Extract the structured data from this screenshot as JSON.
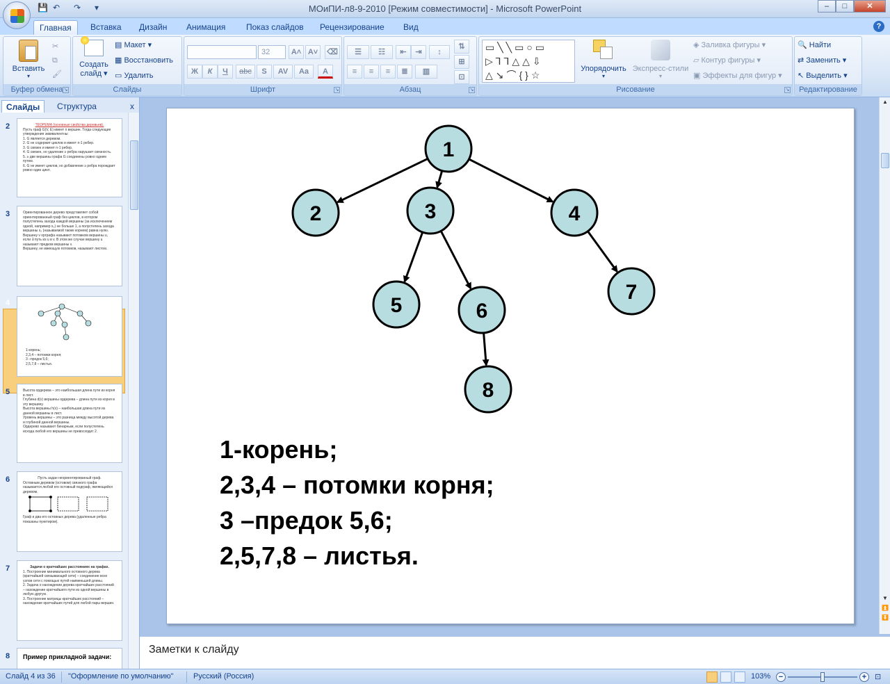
{
  "window": {
    "title": "МОиПИ-л8-9-2010 [Режим совместимости] - Microsoft PowerPoint",
    "minimize": "–",
    "maximize": "□",
    "close": "✕"
  },
  "tabs": [
    {
      "label": "Главная"
    },
    {
      "label": "Вставка"
    },
    {
      "label": "Дизайн"
    },
    {
      "label": "Анимация"
    },
    {
      "label": "Показ слайдов"
    },
    {
      "label": "Рецензирование"
    },
    {
      "label": "Вид"
    }
  ],
  "ribbon": {
    "clipboard": {
      "label": "Буфер обмена",
      "paste": "Вставить"
    },
    "slides": {
      "label": "Слайды",
      "create_line1": "Создать",
      "create_line2": "слайд ▾",
      "layout": "Макет ▾",
      "reset": "Восстановить",
      "delete": "Удалить"
    },
    "font": {
      "label": "Шрифт",
      "font_name": "",
      "font_size": "32",
      "bold": "Ж",
      "italic": "К",
      "underline": "Ч",
      "strike": "abc",
      "shadow": "S",
      "spacing": "AV",
      "case": "Aa",
      "color": "A"
    },
    "paragraph": {
      "label": "Абзац"
    },
    "drawing": {
      "label": "Рисование",
      "arrange": "Упорядочить",
      "quick_styles": "Экспресс-стили",
      "fill": "Заливка фигуры ▾",
      "outline": "Контур фигуры ▾",
      "effects": "Эффекты для фигур ▾"
    },
    "editing": {
      "label": "Редактирование",
      "find": "Найти",
      "replace": "Заменить ▾",
      "select": "Выделить ▾"
    }
  },
  "left_panel": {
    "tab_slides": "Слайды",
    "tab_outline": "Структура",
    "close": "x",
    "thumbnails": [
      {
        "number": "2",
        "lines": [
          "ТЕОРЕМА (основные свойства деревьев).",
          "Пусть граф G(V, E) имеет n вершин. Тогда следующие утверждения эквивалентны:",
          "1. G является деревом.",
          "2. G не содержит циклов и имеет n-1 ребер.",
          "3. G связен и имеет n-1 ребер.",
          "4. G связен, но удаление ≥ ребра нарушает связность.",
          "5. ≥ две вершины графа G соединены ровно одним путем.",
          "6. G не имеет циклов, но добавление ≥ ребра порождает ровно один цикл."
        ]
      },
      {
        "number": "3",
        "lines": [
          "Ориентированное дерево представляет собой ориентированный граф без циклов, в котором полустепень захода каждой вершины (за исключением одной, например x₀) не больше 1, а полустепень захода вершины x₀ (называемой также корнем) равна нулю.",
          "Вершину v орграфа называют потомком вершины u, если ∃ путь из u в v. В этом же случае вершину u называют предком вершины v.",
          "Вершину, не имеющую потомков, называют листом."
        ]
      },
      {
        "number": "4",
        "lines": [
          "1-корень;",
          "2,3,4 – потомки корня;",
          "3 –предок 5,6;",
          "2,5,7,8 – листья."
        ]
      },
      {
        "number": "5",
        "lines": [
          "Высота ордерева – это наибольшая длина пути из корня в лист.",
          "Глубина d(v) вершины ордерева – длина пути из корня в эту вершину.",
          "Высота вершины h(v) – наибольшая длина пути из данной вершины в лист.",
          "Уровень вершины – это разница между высотой дерева и глубиной данной вершины.",
          "Ордерево называют бинарным, если полустепень исхода любой его вершины не превосходит 2."
        ]
      },
      {
        "number": "6",
        "lines": [
          "Пусть задан неориентированный граф.",
          "Остовным деревом (остовом) связного графа называется любой его остовный подграф, являющийся деревом.",
          "Граф и два его остовных дерева (удаленные ребра показаны пунктиром)."
        ]
      },
      {
        "number": "7",
        "lines": [
          "Задачи о кратчайших расстояниях на графах.",
          "1. Построение минимального остовного дерева (кратчайшей связывающей сети) – соединение всех узлов сети с помощью путей наименьшей длины.",
          "2. Задача о нахождении дерева кратчайших расстояний – нахождение кратчайшего пути из одной вершины в любую другую.",
          "3. Построение матрицы кратчайших расстояний – нахождение кратчайших путей для любой пары вершин."
        ]
      },
      {
        "number": "8",
        "lines": [
          "Пример прикладной задачи:"
        ]
      }
    ]
  },
  "slide": {
    "nodes": [
      {
        "label": "1"
      },
      {
        "label": "2"
      },
      {
        "label": "3"
      },
      {
        "label": "4"
      },
      {
        "label": "5"
      },
      {
        "label": "6"
      },
      {
        "label": "7"
      },
      {
        "label": "8"
      }
    ],
    "node_fill": "#b8dde0",
    "lines": [
      "1-корень;",
      "2,3,4 – потомки корня;",
      "3 –предок 5,6;",
      "2,5,7,8 – листья."
    ]
  },
  "notes": {
    "placeholder": "Заметки к слайду"
  },
  "status": {
    "slide": "Слайд 4 из 36",
    "theme": "\"Оформление по умолчанию\"",
    "language": "Русский (Россия)",
    "zoom": "103%"
  }
}
